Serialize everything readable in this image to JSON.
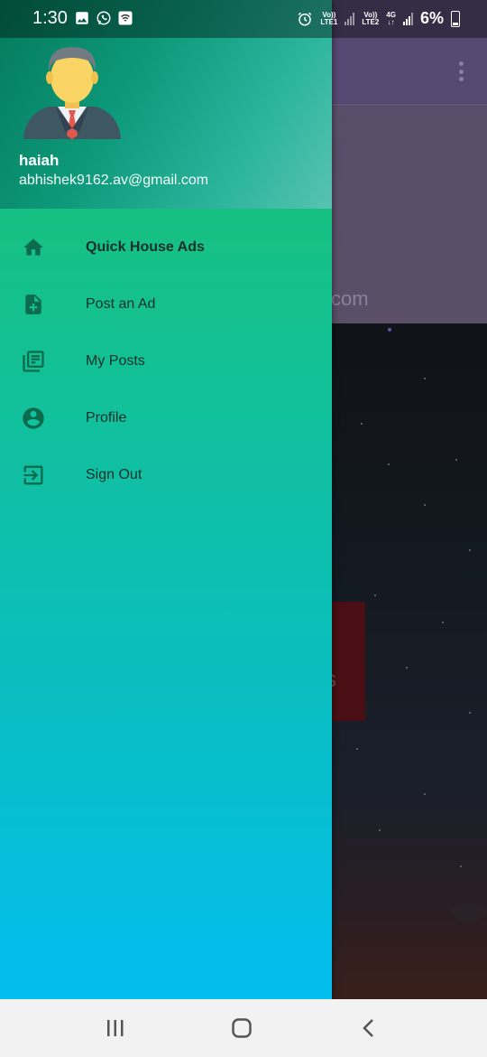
{
  "status_bar": {
    "time": "1:30",
    "left_icons": [
      "image-icon",
      "whatsapp-icon",
      "wifi-icon"
    ],
    "sim1_label_top": "Vo))",
    "sim1_label_bottom": "LTE1",
    "sim2_label_top": "Vo))",
    "sim2_label_bottom": "LTE2",
    "network_type": "4G",
    "battery_percent": "6%"
  },
  "background_app": {
    "email_fragment": "l.com",
    "button_text_fragment": "s"
  },
  "drawer": {
    "user": {
      "name": "haiah",
      "email": "abhishek9162.av@gmail.com"
    },
    "menu_items": [
      {
        "label": "Quick House Ads",
        "icon": "home-icon",
        "bold": true
      },
      {
        "label": "Post an Ad",
        "icon": "add-document-icon",
        "bold": false
      },
      {
        "label": "My Posts",
        "icon": "library-books-icon",
        "bold": false
      },
      {
        "label": "Profile",
        "icon": "account-circle-icon",
        "bold": false
      },
      {
        "label": "Sign Out",
        "icon": "sign-out-icon",
        "bold": false
      }
    ],
    "colors": {
      "header_start": "#047a5c",
      "header_end": "#58c3b0",
      "body_top": "#1dc06a",
      "body_bottom": "#03bdf0",
      "icon_color": "#0b6b4c"
    }
  },
  "nav_bar": {
    "buttons": [
      "recent-apps-icon",
      "home-button-icon",
      "back-icon"
    ]
  }
}
